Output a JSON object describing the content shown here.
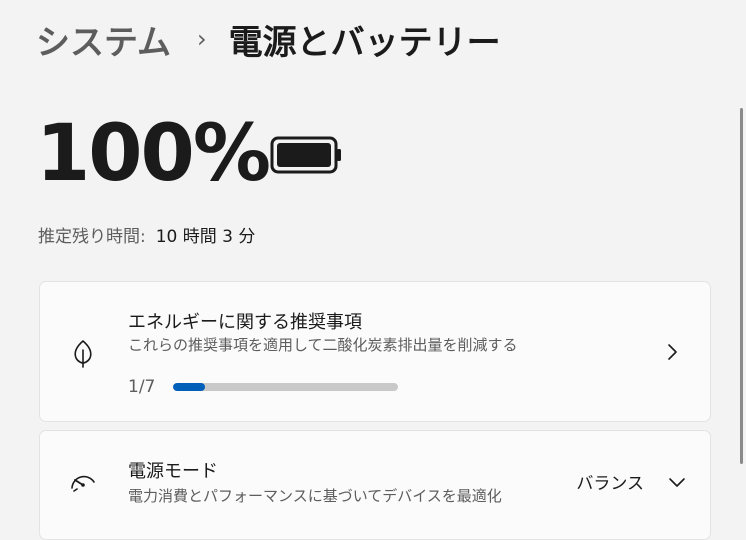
{
  "breadcrumb": {
    "parent": "システム",
    "separator": "›",
    "current": "電源とバッテリー"
  },
  "battery": {
    "percent": "100%",
    "level": 1.0,
    "estimate_label": "推定残り時間:",
    "estimate_value": "10 時間 3 分"
  },
  "recommendations": {
    "title": "エネルギーに関する推奨事項",
    "subtitle": "これらの推奨事項を適用して二酸化炭素排出量を削減する",
    "progress_text": "1/7",
    "progress_fraction": 0.143,
    "icon": "leaf-icon"
  },
  "power_mode": {
    "title": "電源モード",
    "subtitle": "電力消費とパフォーマンスに基づいてデバイスを最適化",
    "value": "バランス",
    "icon": "speedometer-icon"
  },
  "colors": {
    "accent": "#005fb8",
    "background": "#f3f3f3",
    "card": "#fbfbfb"
  }
}
